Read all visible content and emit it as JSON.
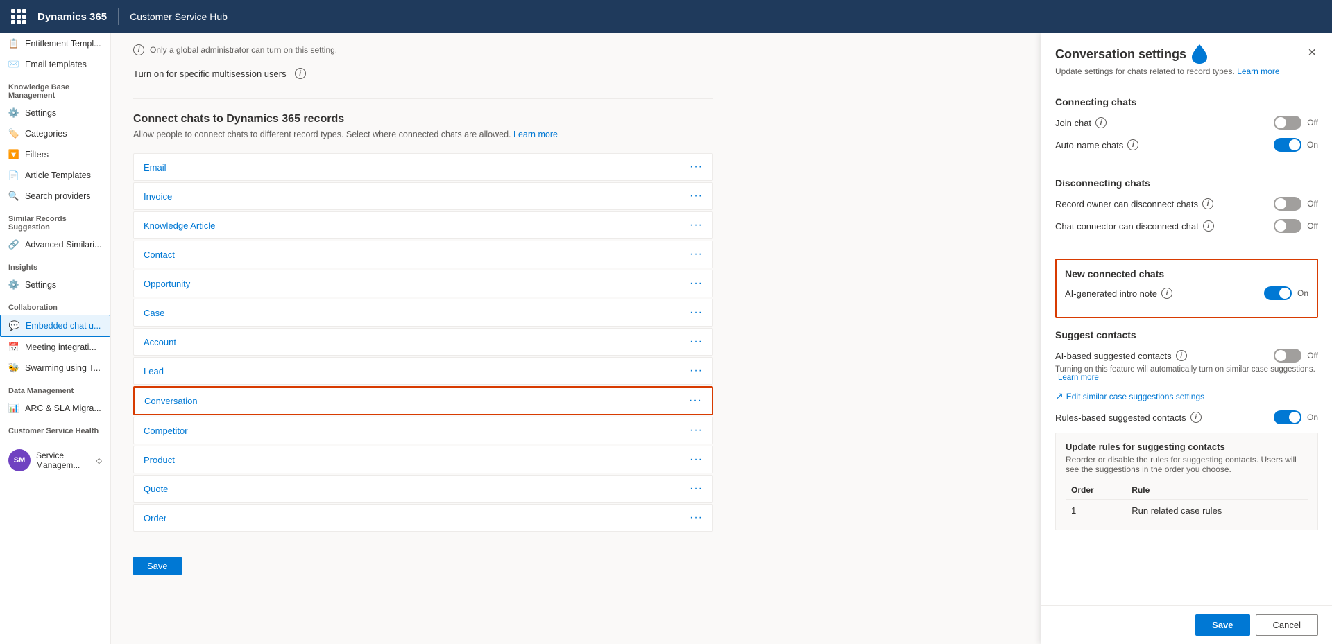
{
  "topbar": {
    "brand": "Dynamics 365",
    "app": "Customer Service Hub"
  },
  "sidebar": {
    "sections": [
      {
        "title": "",
        "items": [
          {
            "id": "entitlement-templ",
            "label": "Entitlement Templ...",
            "icon": "📋",
            "active": false
          },
          {
            "id": "email-templates",
            "label": "Email templates",
            "icon": "✉️",
            "active": false
          }
        ]
      },
      {
        "title": "Knowledge Base Management",
        "items": [
          {
            "id": "settings",
            "label": "Settings",
            "icon": "⚙️",
            "active": false
          },
          {
            "id": "categories",
            "label": "Categories",
            "icon": "🏷️",
            "active": false
          },
          {
            "id": "filters",
            "label": "Filters",
            "icon": "🔽",
            "active": false
          },
          {
            "id": "article-templates",
            "label": "Article Templates",
            "icon": "📄",
            "active": false
          },
          {
            "id": "search-providers",
            "label": "Search providers",
            "icon": "🔍",
            "active": false
          }
        ]
      },
      {
        "title": "Similar Records Suggestion",
        "items": [
          {
            "id": "advanced-similar",
            "label": "Advanced Similari...",
            "icon": "🔗",
            "active": false
          }
        ]
      },
      {
        "title": "Insights",
        "items": [
          {
            "id": "insights-settings",
            "label": "Settings",
            "icon": "⚙️",
            "active": false
          }
        ]
      },
      {
        "title": "Collaboration",
        "items": [
          {
            "id": "embedded-chat",
            "label": "Embedded chat u...",
            "icon": "💬",
            "active": true
          },
          {
            "id": "meeting-integrati",
            "label": "Meeting integrati...",
            "icon": "📅",
            "active": false
          },
          {
            "id": "swarming-using",
            "label": "Swarming using T...",
            "icon": "🐝",
            "active": false
          }
        ]
      },
      {
        "title": "Data Management",
        "items": [
          {
            "id": "arc-sla-migra",
            "label": "ARC & SLA Migra...",
            "icon": "📊",
            "active": false
          }
        ]
      },
      {
        "title": "Customer Service Health",
        "items": []
      }
    ],
    "bottom_item": {
      "label": "Service Managem...",
      "avatar": "SM"
    }
  },
  "main": {
    "admin_notice": "Only a global administrator can turn on this setting.",
    "turn_on_label": "Turn on for specific multisession users",
    "connect_title": "Connect chats to Dynamics 365 records",
    "connect_desc": "Allow people to connect chats to different record types. Select where connected chats are allowed.",
    "connect_learn_more": "Learn more",
    "records": [
      {
        "id": "email",
        "name": "Email",
        "highlighted": false
      },
      {
        "id": "invoice",
        "name": "Invoice",
        "highlighted": false
      },
      {
        "id": "knowledge-article",
        "name": "Knowledge Article",
        "highlighted": false
      },
      {
        "id": "contact",
        "name": "Contact",
        "highlighted": false
      },
      {
        "id": "opportunity",
        "name": "Opportunity",
        "highlighted": false
      },
      {
        "id": "case",
        "name": "Case",
        "highlighted": false
      },
      {
        "id": "account",
        "name": "Account",
        "highlighted": false
      },
      {
        "id": "lead",
        "name": "Lead",
        "highlighted": false
      },
      {
        "id": "conversation",
        "name": "Conversation",
        "highlighted": true
      },
      {
        "id": "competitor",
        "name": "Competitor",
        "highlighted": false
      },
      {
        "id": "product",
        "name": "Product",
        "highlighted": false
      },
      {
        "id": "quote",
        "name": "Quote",
        "highlighted": false
      },
      {
        "id": "order",
        "name": "Order",
        "highlighted": false
      }
    ],
    "save_button": "Save"
  },
  "panel": {
    "title": "Conversation settings",
    "subtitle": "Update settings for chats related to record types.",
    "subtitle_link": "Learn more",
    "connecting_chats": {
      "title": "Connecting chats",
      "join_chat": {
        "label": "Join chat",
        "state": "off",
        "status": "Off"
      },
      "auto_name_chats": {
        "label": "Auto-name chats",
        "state": "on",
        "status": "On"
      }
    },
    "disconnecting_chats": {
      "title": "Disconnecting chats",
      "record_owner": {
        "label": "Record owner can disconnect chats",
        "state": "off",
        "status": "Off"
      },
      "chat_connector": {
        "label": "Chat connector can disconnect chat",
        "state": "off",
        "status": "Off"
      }
    },
    "new_connected_chats": {
      "title": "New connected chats",
      "ai_intro_note": {
        "label": "AI-generated intro note",
        "state": "on",
        "status": "On"
      }
    },
    "suggest_contacts": {
      "title": "Suggest contacts",
      "ai_based": {
        "label": "AI-based suggested contacts",
        "state": "off",
        "status": "Off",
        "desc": "Turning on this feature will automatically turn on similar case suggestions.",
        "learn_more": "Learn more"
      },
      "edit_link": "Edit similar case suggestions settings",
      "rules_based": {
        "label": "Rules-based suggested contacts",
        "state": "on",
        "status": "On"
      },
      "update_rules": {
        "title": "Update rules for suggesting contacts",
        "desc": "Reorder or disable the rules for suggesting contacts. Users will see the suggestions in the order you choose.",
        "order_header": "Order",
        "rule_header": "Rule",
        "rows": [
          {
            "order": "1",
            "rule": "Run related case rules"
          }
        ]
      }
    },
    "save_button": "Save",
    "cancel_button": "Cancel"
  }
}
